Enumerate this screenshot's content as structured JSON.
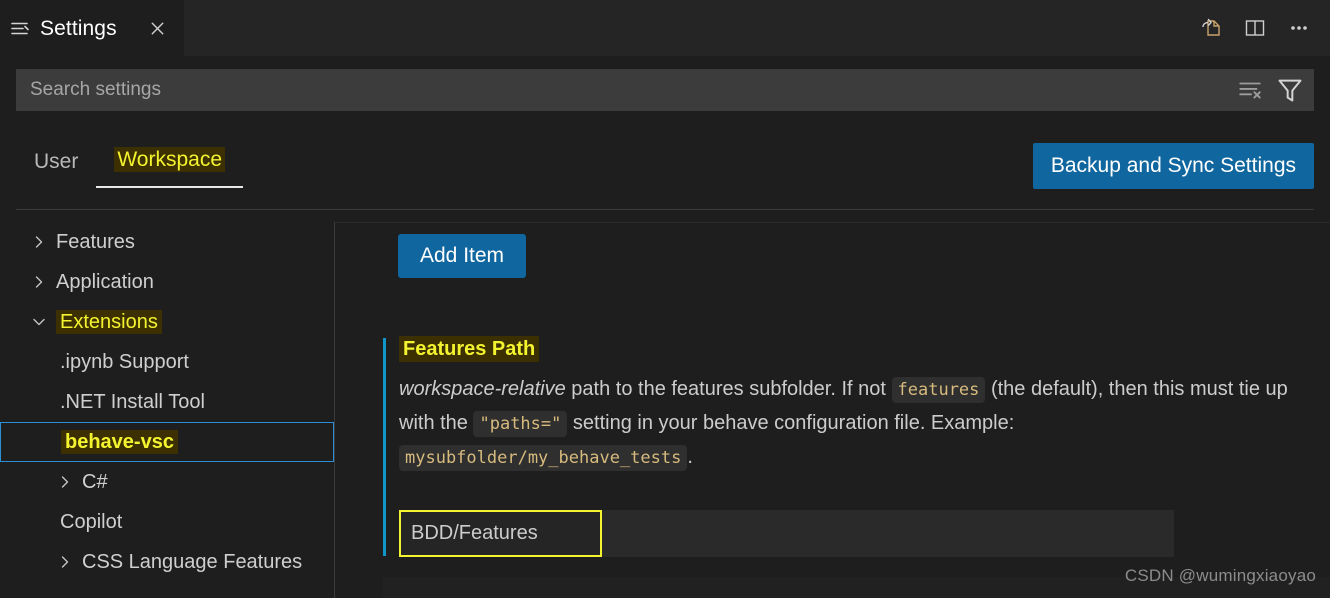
{
  "window": {
    "tab": {
      "title": "Settings",
      "icon": "settings-list-icon",
      "close_icon": "close-icon"
    },
    "actions": [
      {
        "name": "open-settings-json-icon",
        "label": "Open Settings (JSON)"
      },
      {
        "name": "split-editor-icon",
        "label": "Split Editor"
      },
      {
        "name": "more-actions-icon",
        "label": "More Actions..."
      }
    ]
  },
  "search": {
    "placeholder": "Search settings",
    "value": "",
    "clear_icon": "clear-search-icon",
    "filter_icon": "filter-icon"
  },
  "scope": {
    "tabs": [
      {
        "label": "User",
        "active": false,
        "highlighted": false
      },
      {
        "label": "Workspace",
        "active": true,
        "highlighted": true
      }
    ],
    "backup_sync_label": "Backup and Sync Settings"
  },
  "tree": {
    "items": [
      {
        "label": "Features",
        "chevron": "chevron-right-icon",
        "indent": 0,
        "highlighted": false,
        "selected": false
      },
      {
        "label": "Application",
        "chevron": "chevron-right-icon",
        "indent": 0,
        "highlighted": false,
        "selected": false
      },
      {
        "label": "Extensions",
        "chevron": "chevron-down-icon",
        "indent": 0,
        "highlighted": true,
        "selected": false
      },
      {
        "label": ".ipynb Support",
        "chevron": "none",
        "indent": 1,
        "highlighted": false,
        "selected": false
      },
      {
        "label": ".NET Install Tool",
        "chevron": "none",
        "indent": 1,
        "highlighted": false,
        "selected": false
      },
      {
        "label": "behave-vsc",
        "chevron": "none",
        "indent": 1,
        "highlighted": true,
        "selected": true
      },
      {
        "label": "C#",
        "chevron": "chevron-right-icon",
        "indent": 1,
        "highlighted": false,
        "selected": false
      },
      {
        "label": "Copilot",
        "chevron": "none",
        "indent": 1,
        "highlighted": false,
        "selected": false
      },
      {
        "label": "CSS Language Features",
        "chevron": "chevron-right-icon",
        "indent": 1,
        "highlighted": false,
        "selected": false
      }
    ]
  },
  "content": {
    "add_item_label": "Add Item",
    "setting": {
      "title": "Features Path",
      "description_parts": {
        "p1": "workspace-relative",
        "p2": " path to the features subfolder. If not ",
        "code1": "features",
        "p3": " (the default), then this must tie up with the ",
        "code2": "\"paths=\"",
        "p4": " setting in your behave configuration file. Example: ",
        "code3": "mysubfolder/my_behave_tests",
        "p5": "."
      },
      "input_value": "BDD/Features",
      "modified": true
    }
  },
  "watermark": "CSDN @wumingxiaoyao",
  "colors": {
    "background": "#1e1e1e",
    "tabbar": "#252526",
    "accent_blue": "#10669e",
    "focus_blue": "#2a8fd4",
    "highlight_yellow": "#f3f32f",
    "highlight_bg": "#3d3000",
    "modified_bar": "#0f97c7",
    "code_text": "#d7ba7d",
    "search_bg": "#3c3c3c"
  }
}
